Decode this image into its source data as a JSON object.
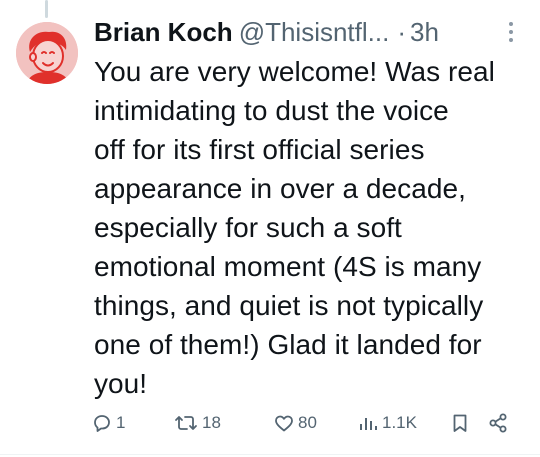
{
  "tweet": {
    "author": {
      "display_name": "Brian Koch",
      "handle": "@Thisisntfl..."
    },
    "separator": "·",
    "timestamp": "3h",
    "lines": [
      "You are very welcome! Was real",
      "intimidating to dust the voice",
      "off for its first official series",
      "appearance in over a decade,",
      "especially for such a soft",
      "emotional moment (4S is many",
      "things, and quiet is not typically",
      "one of them!) Glad it landed for",
      "you!"
    ]
  },
  "actions": {
    "replies": "1",
    "retweets": "18",
    "likes": "80",
    "views": "1.1K"
  },
  "icons": {
    "reply": "reply-icon",
    "retweet": "retweet-icon",
    "like": "heart-icon",
    "views": "views-icon",
    "bookmark": "bookmark-icon",
    "share": "share-icon",
    "more": "more-options-icon"
  },
  "colors": {
    "text_primary": "#0f1419",
    "text_secondary": "#536471",
    "avatar_bg": "#f2c2c0",
    "avatar_fg": "#e0302b"
  }
}
